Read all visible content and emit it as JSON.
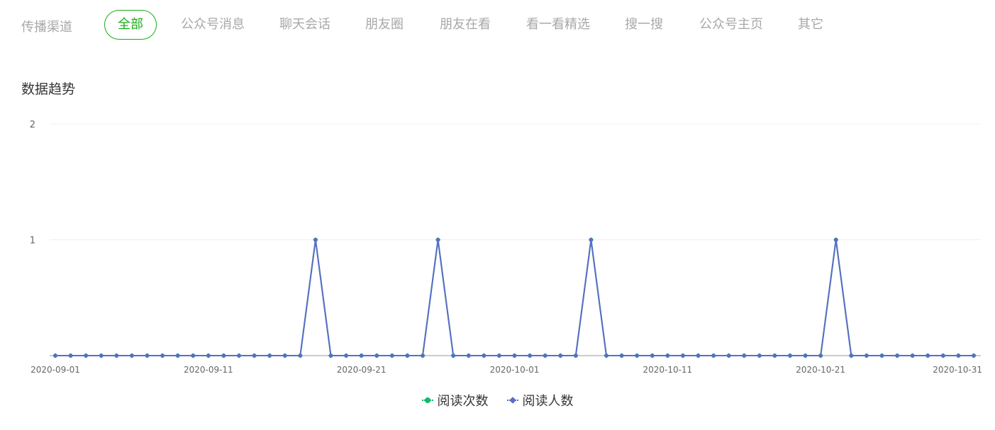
{
  "channel_bar": {
    "label": "传播渠道",
    "tabs": [
      {
        "label": "全部",
        "active": true
      },
      {
        "label": "公众号消息",
        "active": false
      },
      {
        "label": "聊天会话",
        "active": false
      },
      {
        "label": "朋友圈",
        "active": false
      },
      {
        "label": "朋友在看",
        "active": false
      },
      {
        "label": "看一看精选",
        "active": false
      },
      {
        "label": "搜一搜",
        "active": false
      },
      {
        "label": "公众号主页",
        "active": false
      },
      {
        "label": "其它",
        "active": false
      }
    ]
  },
  "section": {
    "title": "数据趋势"
  },
  "colors": {
    "accent": "#1aad19",
    "read_count": "#12b96a",
    "reader_count": "#5b6cc8"
  },
  "chart_data": {
    "type": "line",
    "title": "",
    "xlabel": "",
    "ylabel": "",
    "ylim": [
      0,
      2
    ],
    "y_ticks": [
      "1",
      "2"
    ],
    "x_tick_labels": [
      "2020-09-01",
      "2020-09-11",
      "2020-09-21",
      "2020-10-01",
      "2020-10-11",
      "2020-10-21",
      "2020-10-31"
    ],
    "x_start": "2020-09-01",
    "x_end": "2020-10-31",
    "grid": true,
    "legend_position": "bottom-center",
    "series": [
      {
        "name": "阅读次数",
        "color": "#12b96a",
        "marker": "circle",
        "peaks": [
          "2020-09-18",
          "2020-09-26",
          "2020-10-06",
          "2020-10-22"
        ],
        "values": [
          0,
          0,
          0,
          0,
          0,
          0,
          0,
          0,
          0,
          0,
          0,
          0,
          0,
          0,
          0,
          0,
          0,
          1,
          0,
          0,
          0,
          0,
          0,
          0,
          0,
          1,
          0,
          0,
          0,
          0,
          0,
          0,
          0,
          0,
          0,
          1,
          0,
          0,
          0,
          0,
          0,
          0,
          0,
          0,
          0,
          0,
          0,
          0,
          0,
          0,
          0,
          1,
          0,
          0,
          0,
          0,
          0,
          0,
          0,
          0,
          0
        ]
      },
      {
        "name": "阅读人数",
        "color": "#5b6cc8",
        "marker": "diamond",
        "peaks": [
          "2020-09-18",
          "2020-09-26",
          "2020-10-06",
          "2020-10-22"
        ],
        "values": [
          0,
          0,
          0,
          0,
          0,
          0,
          0,
          0,
          0,
          0,
          0,
          0,
          0,
          0,
          0,
          0,
          0,
          1,
          0,
          0,
          0,
          0,
          0,
          0,
          0,
          1,
          0,
          0,
          0,
          0,
          0,
          0,
          0,
          0,
          0,
          1,
          0,
          0,
          0,
          0,
          0,
          0,
          0,
          0,
          0,
          0,
          0,
          0,
          0,
          0,
          0,
          1,
          0,
          0,
          0,
          0,
          0,
          0,
          0,
          0,
          0
        ]
      }
    ]
  }
}
